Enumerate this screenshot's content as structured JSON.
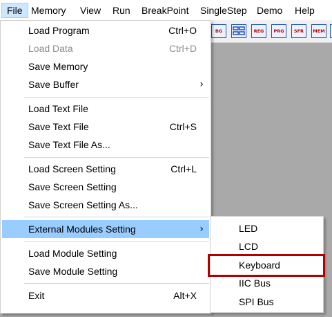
{
  "menubar": {
    "items": [
      "File",
      "Memory",
      "View",
      "Run",
      "BreakPoint",
      "SingleStep",
      "Demo",
      "Help"
    ]
  },
  "toolbar": {
    "buttons": [
      {
        "label": "BG",
        "icon": "toolbar-icon-partial"
      },
      {
        "label": "",
        "icon": "grid-icon"
      },
      {
        "label": "REG",
        "icon": "reg-icon"
      },
      {
        "label": "PRG",
        "icon": "prg-icon"
      },
      {
        "label": "SFR",
        "icon": "sfr-icon"
      },
      {
        "label": "MEM",
        "icon": "mem-icon"
      },
      {
        "label": "",
        "icon": "toolbar-icon-partial-right"
      }
    ]
  },
  "file_menu": {
    "items": [
      {
        "label": "Load Program",
        "shortcut": "Ctrl+O"
      },
      {
        "label": "Load Data",
        "shortcut": "Ctrl+D",
        "disabled": true
      },
      {
        "label": "Save Memory",
        "shortcut": ""
      },
      {
        "label": "Save Buffer",
        "shortcut": "",
        "submenu": true
      },
      {
        "label": "Load Text File",
        "shortcut": ""
      },
      {
        "label": "Save Text File",
        "shortcut": "Ctrl+S"
      },
      {
        "label": "Save Text File As...",
        "shortcut": ""
      },
      {
        "label": "Load Screen Setting",
        "shortcut": "Ctrl+L"
      },
      {
        "label": "Save Screen Setting",
        "shortcut": ""
      },
      {
        "label": "Save Screen Setting As...",
        "shortcut": ""
      },
      {
        "label": "External Modules Setting",
        "shortcut": "",
        "submenu": true,
        "highlighted": true
      },
      {
        "label": "Load Module Setting",
        "shortcut": ""
      },
      {
        "label": "Save Module Setting",
        "shortcut": ""
      },
      {
        "label": "Exit",
        "shortcut": "Alt+X"
      }
    ],
    "arrow_glyph": "›"
  },
  "external_modules_submenu": {
    "items": [
      "LED",
      "LCD",
      "Keyboard",
      "IIC Bus",
      "SPI Bus"
    ],
    "highlighted_item": "Keyboard"
  },
  "colors": {
    "menu_highlight": "#99ccff",
    "annotation_box": "#b00000",
    "workspace": "#a9a9a9"
  }
}
